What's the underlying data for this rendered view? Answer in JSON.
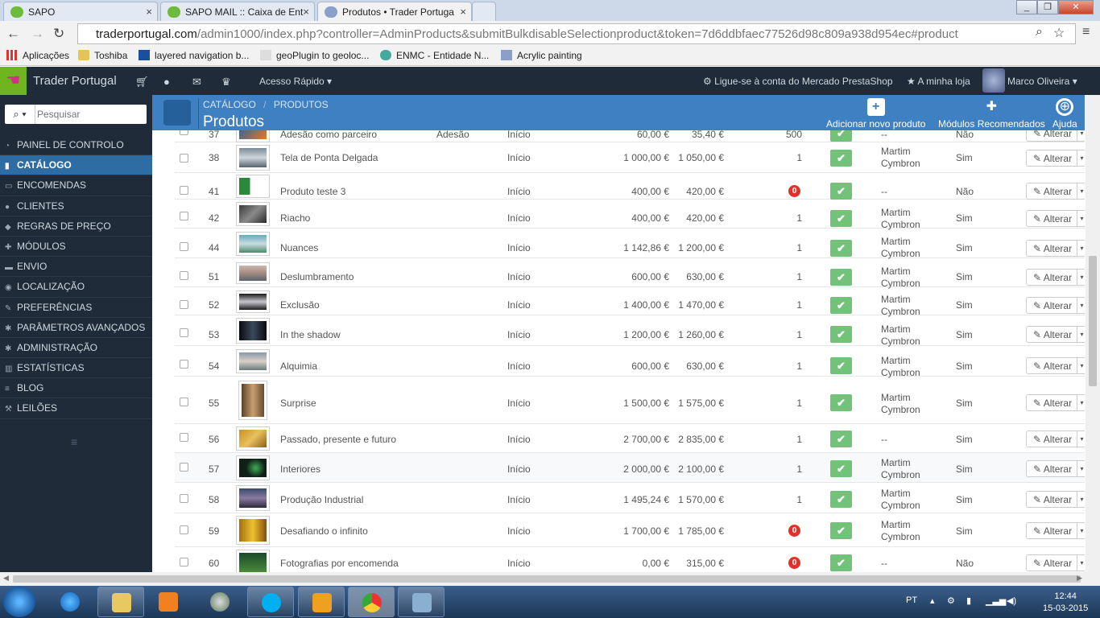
{
  "browser": {
    "tabs": [
      {
        "label": "SAPO"
      },
      {
        "label": "SAPO MAIL :: Caixa de Ent"
      },
      {
        "label": "Produtos • Trader Portuga"
      }
    ],
    "url_host": "traderportugal.com",
    "url_path": "/admin1000/index.php?controller=AdminProducts&submitBulkdisableSelectionproduct&token=7d6ddbfaec77526d98c809a938d954ec#product",
    "bookmarks": [
      "Aplicações",
      "Toshiba",
      "layered navigation b...",
      "geoPlugin to geoloc...",
      "ENMC - Entidade N...",
      "Acrylic painting"
    ]
  },
  "topbar": {
    "brand": "Trader Portugal",
    "quick_access": "Acesso Rápido",
    "marketplace": "Ligue-se à conta do Mercado PrestaShop",
    "my_shop": "A minha loja",
    "user": "Marco Oliveira"
  },
  "sidebar": {
    "search_placeholder": "Pesquisar",
    "items": [
      {
        "label": "PAINEL DE CONTROLO"
      },
      {
        "label": "CATÁLOGO"
      },
      {
        "label": "ENCOMENDAS"
      },
      {
        "label": "CLIENTES"
      },
      {
        "label": "REGRAS DE PREÇO"
      },
      {
        "label": "MÓDULOS"
      },
      {
        "label": "ENVIO"
      },
      {
        "label": "LOCALIZAÇÃO"
      },
      {
        "label": "PREFERÊNCIAS"
      },
      {
        "label": "PARÂMETROS AVANÇADOS"
      },
      {
        "label": "ADMINISTRAÇÃO"
      },
      {
        "label": "ESTATÍSTICAS"
      },
      {
        "label": "BLOG"
      },
      {
        "label": "LEILÕES"
      }
    ]
  },
  "header": {
    "breadcrumb_1": "CATÁLOGO",
    "breadcrumb_2": "PRODUTOS",
    "title": "Produtos",
    "add_label": "Adicionar novo produto",
    "modules_label": "Módulos Recomendados",
    "help_label": "Ajuda"
  },
  "edit_label": "Alterar",
  "rows": [
    {
      "id": "37",
      "name": "Adesão como parceiro",
      "ref": "Adesão",
      "cat": "Início",
      "price": "60,00 €",
      "price_tax": "35,40 €",
      "qty": "500",
      "zero": false,
      "seller1": "--",
      "seller2": "",
      "status": "Não"
    },
    {
      "id": "38",
      "name": "Tela de Ponta Delgada",
      "ref": "",
      "cat": "Início",
      "price": "1 000,00 €",
      "price_tax": "1 050,00 €",
      "qty": "1",
      "zero": false,
      "seller1": "Martim",
      "seller2": "Cymbron",
      "status": "Sim"
    },
    {
      "id": "41",
      "name": "Produto teste 3",
      "ref": "",
      "cat": "Início",
      "price": "400,00 €",
      "price_tax": "420,00 €",
      "qty": "0",
      "zero": true,
      "seller1": "--",
      "seller2": "",
      "status": "Não"
    },
    {
      "id": "42",
      "name": "Riacho",
      "ref": "",
      "cat": "Início",
      "price": "400,00 €",
      "price_tax": "420,00 €",
      "qty": "1",
      "zero": false,
      "seller1": "Martim",
      "seller2": "Cymbron",
      "status": "Sim"
    },
    {
      "id": "44",
      "name": "Nuances",
      "ref": "",
      "cat": "Início",
      "price": "1 142,86 €",
      "price_tax": "1 200,00 €",
      "qty": "1",
      "zero": false,
      "seller1": "Martim",
      "seller2": "Cymbron",
      "status": "Sim"
    },
    {
      "id": "51",
      "name": "Deslumbramento",
      "ref": "",
      "cat": "Início",
      "price": "600,00 €",
      "price_tax": "630,00 €",
      "qty": "1",
      "zero": false,
      "seller1": "Martim",
      "seller2": "Cymbron",
      "status": "Sim"
    },
    {
      "id": "52",
      "name": "Exclusão",
      "ref": "",
      "cat": "Início",
      "price": "1 400,00 €",
      "price_tax": "1 470,00 €",
      "qty": "1",
      "zero": false,
      "seller1": "Martim",
      "seller2": "Cymbron",
      "status": "Sim"
    },
    {
      "id": "53",
      "name": "In the shadow",
      "ref": "",
      "cat": "Início",
      "price": "1 200,00 €",
      "price_tax": "1 260,00 €",
      "qty": "1",
      "zero": false,
      "seller1": "Martim",
      "seller2": "Cymbron",
      "status": "Sim"
    },
    {
      "id": "54",
      "name": "Alquimia",
      "ref": "",
      "cat": "Início",
      "price": "600,00 €",
      "price_tax": "630,00 €",
      "qty": "1",
      "zero": false,
      "seller1": "Martim",
      "seller2": "Cymbron",
      "status": "Sim"
    },
    {
      "id": "55",
      "name": "Surprise",
      "ref": "",
      "cat": "Início",
      "price": "1 500,00 €",
      "price_tax": "1 575,00 €",
      "qty": "1",
      "zero": false,
      "seller1": "Martim",
      "seller2": "Cymbron",
      "status": "Sim"
    },
    {
      "id": "56",
      "name": "Passado, presente e futuro",
      "ref": "",
      "cat": "Início",
      "price": "2 700,00 €",
      "price_tax": "2 835,00 €",
      "qty": "1",
      "zero": false,
      "seller1": "--",
      "seller2": "",
      "status": "Sim"
    },
    {
      "id": "57",
      "name": "Interiores",
      "ref": "",
      "cat": "Início",
      "price": "2 000,00 €",
      "price_tax": "2 100,00 €",
      "qty": "1",
      "zero": false,
      "seller1": "Martim",
      "seller2": "Cymbron",
      "status": "Sim"
    },
    {
      "id": "58",
      "name": "Produção Industrial",
      "ref": "",
      "cat": "Início",
      "price": "1 495,24 €",
      "price_tax": "1 570,00 €",
      "qty": "1",
      "zero": false,
      "seller1": "Martim",
      "seller2": "Cymbron",
      "status": "Sim"
    },
    {
      "id": "59",
      "name": "Desafiando o infinito",
      "ref": "",
      "cat": "Início",
      "price": "1 700,00 €",
      "price_tax": "1 785,00 €",
      "qty": "0",
      "zero": true,
      "seller1": "Martim",
      "seller2": "Cymbron",
      "status": "Sim"
    },
    {
      "id": "60",
      "name": "Fotografias por encomenda",
      "ref": "",
      "cat": "Início",
      "price": "0,00 €",
      "price_tax": "315,00 €",
      "qty": "0",
      "zero": true,
      "seller1": "--",
      "seller2": "",
      "status": "Não"
    }
  ],
  "taskbar": {
    "lang": "PT",
    "time": "12:44",
    "date": "15-03-2015"
  }
}
